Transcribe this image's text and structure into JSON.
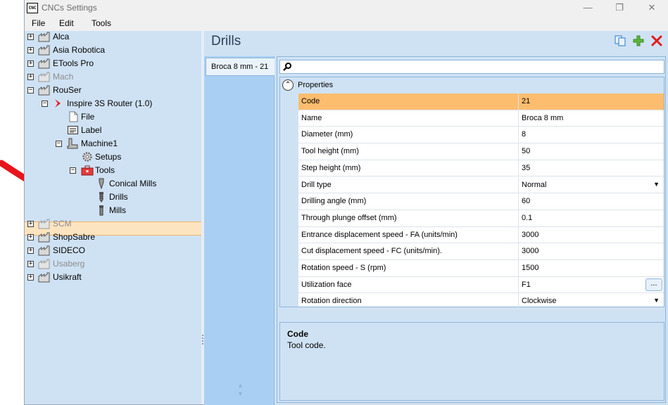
{
  "window": {
    "title": "CNCs Settings",
    "app_icon_text": "CNC",
    "controls": [
      "—",
      "❐",
      "✕"
    ]
  },
  "menu": [
    "File",
    "Edit",
    "Tools"
  ],
  "tree": {
    "nodes": [
      {
        "label": "Alca",
        "expander": "+"
      },
      {
        "label": "Asia Robotica",
        "expander": "+"
      },
      {
        "label": "ETools Pro",
        "expander": "+"
      },
      {
        "label": "Mach",
        "expander": "+"
      },
      {
        "label": "RouSer",
        "expander": "−"
      },
      {
        "label": "Inspire 3S Router (1.0)",
        "expander": "−"
      },
      {
        "label": "File"
      },
      {
        "label": "Label"
      },
      {
        "label": "Machine1",
        "expander": "−"
      },
      {
        "label": "Setups"
      },
      {
        "label": "Tools",
        "expander": "−"
      },
      {
        "label": "Conical Mills"
      },
      {
        "label": "Drills"
      },
      {
        "label": "Mills"
      },
      {
        "label": "SCM",
        "expander": "+"
      },
      {
        "label": "ShopSabre",
        "expander": "+"
      },
      {
        "label": "SIDECO",
        "expander": "+"
      },
      {
        "label": "Usaberg",
        "expander": "+"
      },
      {
        "label": "Usikraft",
        "expander": "+"
      }
    ],
    "selected": "Drills"
  },
  "header": {
    "title": "Drills",
    "icons": [
      "copy-icon",
      "add-icon",
      "delete-icon"
    ]
  },
  "tools_list": [
    "Broca 8 mm - 21"
  ],
  "properties": {
    "category": "Properties",
    "category_toggle": "⌃",
    "rows": [
      {
        "name": "Code",
        "value": "21"
      },
      {
        "name": "Name",
        "value": "Broca 8 mm"
      },
      {
        "name": "Diameter (mm)",
        "value": "8"
      },
      {
        "name": "Tool height (mm)",
        "value": "50"
      },
      {
        "name": "Step height (mm)",
        "value": "35"
      },
      {
        "name": "Drill type",
        "value": "Normal"
      },
      {
        "name": "Drilling angle (mm)",
        "value": "60"
      },
      {
        "name": "Through plunge offset (mm)",
        "value": "0.1"
      },
      {
        "name": "Entrance displacement speed - FA (units/min)",
        "value": "3000"
      },
      {
        "name": "Cut displacement speed - FC (units/min).",
        "value": "3000"
      },
      {
        "name": "Rotation speed - S (rpm)",
        "value": "1500"
      },
      {
        "name": "Utilization face",
        "value": "F1"
      },
      {
        "name": "Rotation direction",
        "value": "Clockwise"
      }
    ],
    "ellipsis_label": "..."
  },
  "description": {
    "title": "Code",
    "text": "Tool code."
  },
  "colors": {
    "panel_bg": "#cfe2f4",
    "selected_row": "#fcbd6e",
    "tree_selected": "#fde4c0",
    "annotation_arrow": "#e8141c"
  }
}
